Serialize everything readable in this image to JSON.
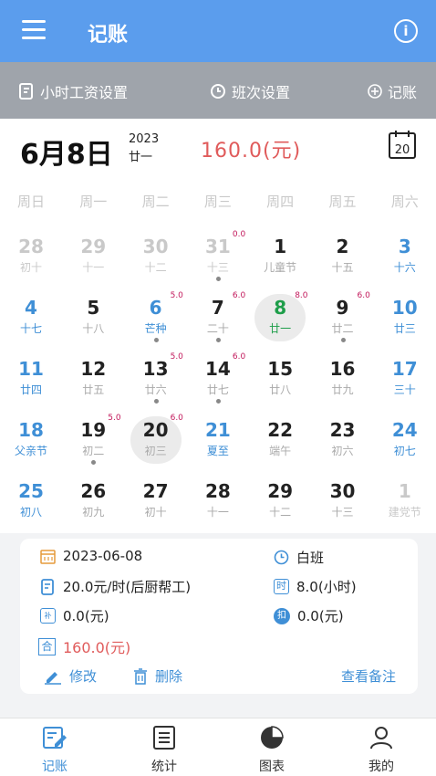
{
  "appbar": {
    "title": "记账"
  },
  "toolbar": {
    "wage": "小时工资设置",
    "shift": "班次设置",
    "record": "记账"
  },
  "header": {
    "date": "6月8日",
    "year": "2023",
    "lunar": "廿一",
    "total": "160.0(元)"
  },
  "calendar": {
    "weekdays": [
      "周日",
      "周一",
      "周二",
      "周三",
      "周四",
      "周五",
      "周六"
    ],
    "days": [
      {
        "n": "28",
        "s": "初十",
        "type": "muted"
      },
      {
        "n": "29",
        "s": "十一",
        "type": "muted"
      },
      {
        "n": "30",
        "s": "十二",
        "type": "muted"
      },
      {
        "n": "31",
        "s": "十三",
        "type": "muted",
        "amt": "0.0",
        "dot": true
      },
      {
        "n": "1",
        "s": "儿童节",
        "type": "normal"
      },
      {
        "n": "2",
        "s": "十五",
        "type": "normal"
      },
      {
        "n": "3",
        "s": "十六",
        "type": "weekend"
      },
      {
        "n": "4",
        "s": "十七",
        "type": "weekend"
      },
      {
        "n": "5",
        "s": "十八",
        "type": "normal"
      },
      {
        "n": "6",
        "s": "芒种",
        "type": "term",
        "amt": "5.0",
        "dot": true
      },
      {
        "n": "7",
        "s": "二十",
        "type": "normal",
        "amt": "6.0",
        "dot": true
      },
      {
        "n": "8",
        "s": "廿一",
        "type": "today",
        "amt": "8.0"
      },
      {
        "n": "9",
        "s": "廿二",
        "type": "normal",
        "amt": "6.0",
        "dot": true
      },
      {
        "n": "10",
        "s": "廿三",
        "type": "weekend"
      },
      {
        "n": "11",
        "s": "廿四",
        "type": "weekend"
      },
      {
        "n": "12",
        "s": "廿五",
        "type": "normal"
      },
      {
        "n": "13",
        "s": "廿六",
        "type": "normal",
        "amt": "5.0",
        "dot": true
      },
      {
        "n": "14",
        "s": "廿七",
        "type": "normal",
        "amt": "6.0",
        "dot": true
      },
      {
        "n": "15",
        "s": "廿八",
        "type": "normal"
      },
      {
        "n": "16",
        "s": "廿九",
        "type": "normal"
      },
      {
        "n": "17",
        "s": "三十",
        "type": "weekend"
      },
      {
        "n": "18",
        "s": "父亲节",
        "type": "weekend"
      },
      {
        "n": "19",
        "s": "初二",
        "type": "normal",
        "amt": "5.0",
        "dot": true
      },
      {
        "n": "20",
        "s": "初三",
        "type": "selected",
        "amt": "6.0"
      },
      {
        "n": "21",
        "s": "夏至",
        "type": "term"
      },
      {
        "n": "22",
        "s": "端午",
        "type": "normal"
      },
      {
        "n": "23",
        "s": "初六",
        "type": "normal"
      },
      {
        "n": "24",
        "s": "初七",
        "type": "weekend"
      },
      {
        "n": "25",
        "s": "初八",
        "type": "weekend"
      },
      {
        "n": "26",
        "s": "初九",
        "type": "normal"
      },
      {
        "n": "27",
        "s": "初十",
        "type": "normal"
      },
      {
        "n": "28",
        "s": "十一",
        "type": "normal"
      },
      {
        "n": "29",
        "s": "十二",
        "type": "normal"
      },
      {
        "n": "30",
        "s": "十三",
        "type": "normal"
      },
      {
        "n": "1",
        "s": "建党节",
        "type": "muted"
      }
    ]
  },
  "detail": {
    "date": "2023-06-08",
    "shift": "白班",
    "wage": "20.0元/时(后厨帮工)",
    "hours": "8.0(小时)",
    "subsidy": "0.0(元)",
    "deduction": "0.0(元)",
    "total": "160.0(元)",
    "edit": "修改",
    "delete": "删除",
    "notes": "查看备注",
    "hour_badge": "时",
    "deduct_badge": "扣",
    "subsidy_badge": "补",
    "total_badge": "合"
  },
  "tabs": [
    "记账",
    "统计",
    "图表",
    "我的"
  ],
  "colors": {
    "primary": "#5b9ded",
    "accent_red": "#e05b5b",
    "holiday_blue": "#3f8fd6",
    "term_green": "#1e9e4a",
    "muted": "#c9c9c9"
  }
}
